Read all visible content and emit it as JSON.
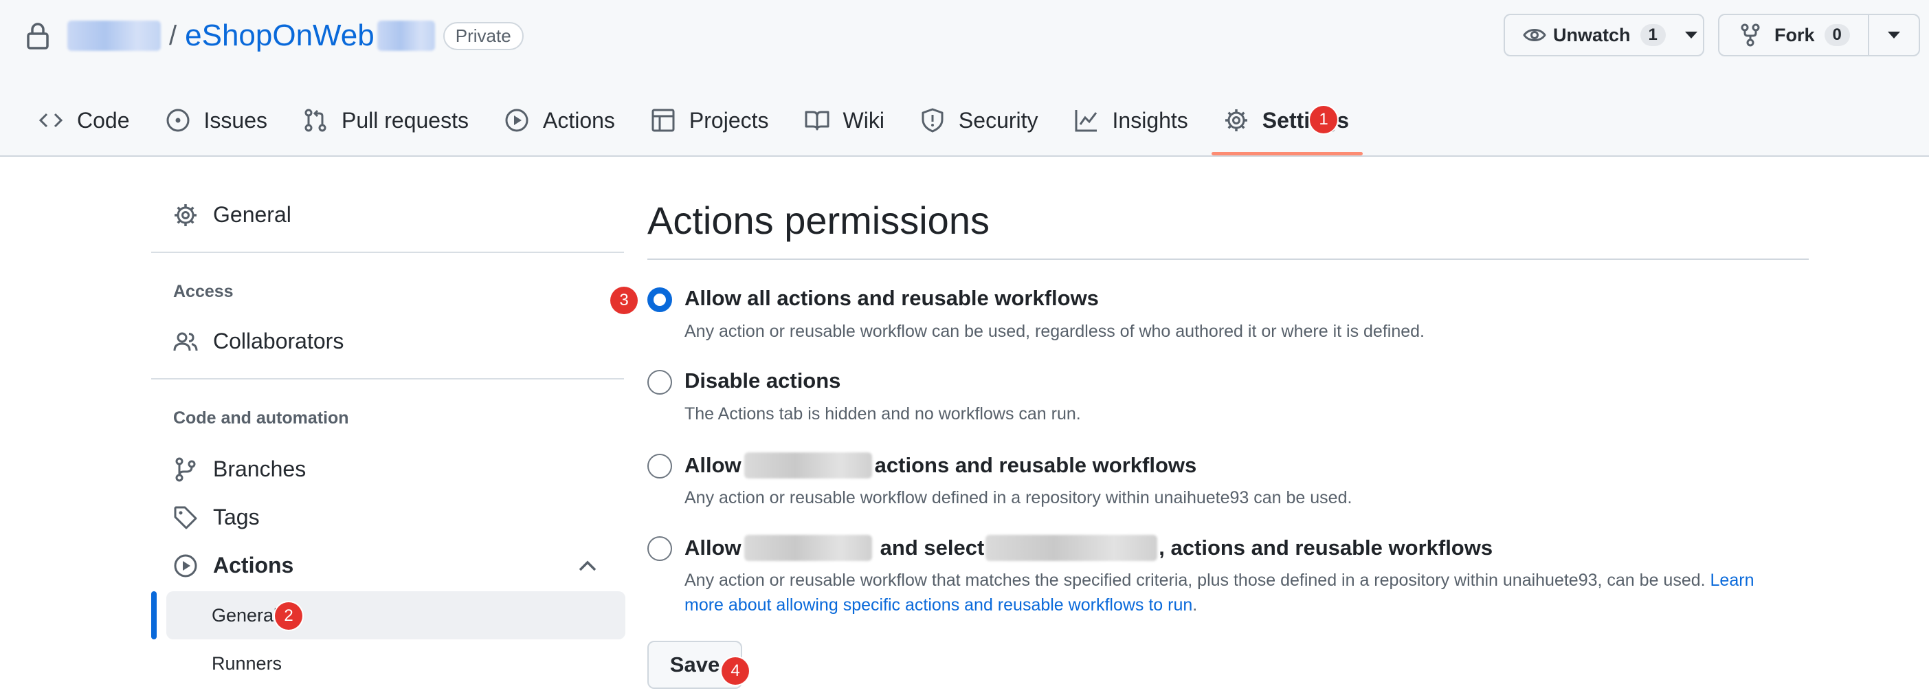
{
  "repo": {
    "name": "eShopOnWeb",
    "visibility": "Private"
  },
  "header_buttons": {
    "unwatch": {
      "label": "Unwatch",
      "count": "1"
    },
    "fork": {
      "label": "Fork",
      "count": "0"
    }
  },
  "tabs": [
    {
      "label": "Code",
      "icon": "code-icon"
    },
    {
      "label": "Issues",
      "icon": "issue-icon"
    },
    {
      "label": "Pull requests",
      "icon": "pull-request-icon"
    },
    {
      "label": "Actions",
      "icon": "play-icon"
    },
    {
      "label": "Projects",
      "icon": "table-icon"
    },
    {
      "label": "Wiki",
      "icon": "book-icon"
    },
    {
      "label": "Security",
      "icon": "shield-icon"
    },
    {
      "label": "Insights",
      "icon": "graph-icon"
    },
    {
      "label": "Settings",
      "icon": "gear-icon",
      "selected": true
    }
  ],
  "sidebar": {
    "general": "General",
    "access_heading": "Access",
    "collaborators": "Collaborators",
    "code_automation_heading": "Code and automation",
    "branches": "Branches",
    "tags": "Tags",
    "actions": "Actions",
    "actions_sub": {
      "general": "General",
      "runners": "Runners"
    }
  },
  "main": {
    "title": "Actions permissions",
    "options": [
      {
        "label": "Allow all actions and reusable workflows",
        "desc": "Any action or reusable workflow can be used, regardless of who authored it or where it is defined.",
        "selected": true
      },
      {
        "label": "Disable actions",
        "desc": "The Actions tab is hidden and no workflows can run."
      },
      {
        "label_pre": "Allow",
        "label_post": "actions and reusable workflows",
        "desc": "Any action or reusable workflow defined in a repository within unaihuete93 can be used."
      },
      {
        "label_pre": "Allow",
        "label_mid": "and select",
        "label_post": ", actions and reusable workflows",
        "desc": "Any action or reusable workflow that matches the specified criteria, plus those defined in a repository within unaihuete93, can be used.",
        "link_part1": "Learn",
        "link_part2": "more about allowing specific actions and reusable workflows to run",
        "desc_end": "."
      }
    ],
    "save": "Save"
  },
  "markers": [
    "1",
    "2",
    "3",
    "4"
  ],
  "colors": {
    "accent": "#0969da",
    "tab_underline": "#fd8c73",
    "marker": "#e5322d"
  }
}
